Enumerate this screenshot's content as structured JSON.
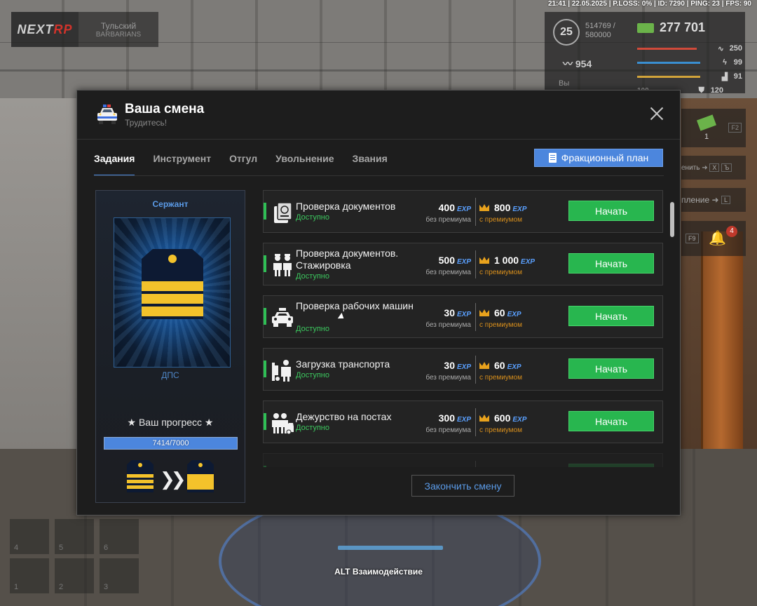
{
  "hud": {
    "status_line": "21:41 | 22.05.2025 | P.LOSS: 0% | ID: 7290 | PING: 23 | FPS: 90",
    "logo_text": "NEXT",
    "logo_text_accent": "RP",
    "server_name": "Тульский",
    "server_sub": "BARBARIANS",
    "level": "25",
    "xp_current": "514769 /",
    "xp_total": "580000",
    "money": "277 701",
    "fans": "954",
    "bars": [
      {
        "value": "250",
        "color": "#d14a3a"
      },
      {
        "value": "99",
        "color": "#3a8fd1"
      },
      {
        "value": "91",
        "color": "#d1a33a"
      },
      {
        "value": "120",
        "color": "#8a9cc0"
      }
    ],
    "bar_left_value": "100",
    "left_label": "Вы",
    "item_count": "1",
    "key_f2": "F2",
    "hint_change": "енить",
    "key_x": "X",
    "key_b": "Ъ",
    "hint_control": "пление",
    "key_l": "L",
    "key_f9": "F9",
    "notifications": "4",
    "slots": [
      "4",
      "5",
      "6",
      "1",
      "2",
      "3"
    ],
    "alt_hint": "ALT Взаимодействие"
  },
  "modal": {
    "title": "Ваша смена",
    "subtitle": "Трудитесь!",
    "tabs": [
      {
        "label": "Задания",
        "active": true
      },
      {
        "label": "Инструмент",
        "active": false
      },
      {
        "label": "Отгул",
        "active": false
      },
      {
        "label": "Увольнение",
        "active": false
      },
      {
        "label": "Звания",
        "active": false
      }
    ],
    "plan_button": "Фракционный план",
    "rank": {
      "name": "Сержант",
      "department": "ДПС",
      "progress_label": "★ Ваш прогресс ★",
      "progress_text": "7414/7000",
      "progress_fraction": 1.0
    },
    "exp_tag": "EXP",
    "no_premium_label": "без премиума",
    "premium_label": "с премиумом",
    "start_label": "Начать",
    "status_available": "Доступно",
    "tasks": [
      {
        "name": "Проверка документов",
        "exp": "400",
        "exp_premium": "800"
      },
      {
        "name": "Проверка документов. Стажировка",
        "exp": "500",
        "exp_premium": "1 000"
      },
      {
        "name": "Проверка рабочих машин",
        "exp": "30",
        "exp_premium": "60"
      },
      {
        "name": "Загрузка транспорта",
        "exp": "30",
        "exp_premium": "60"
      },
      {
        "name": "Дежурство на постах",
        "exp": "300",
        "exp_premium": "600"
      }
    ],
    "end_shift_button": "Закончить смену"
  }
}
